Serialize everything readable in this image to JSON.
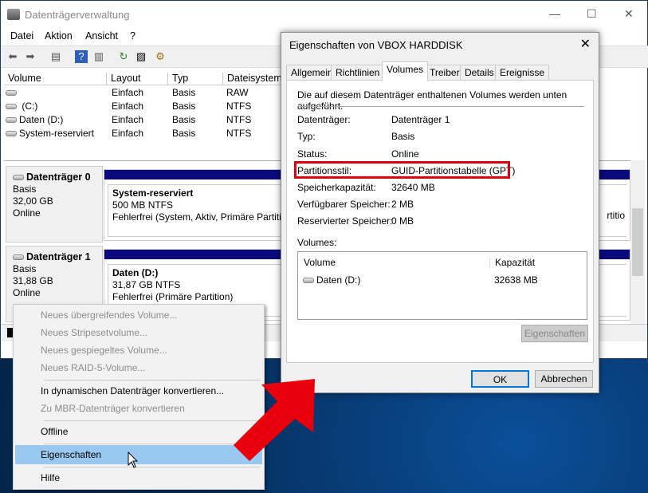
{
  "main": {
    "title": "Datenträgerverwaltung",
    "menu": [
      "Datei",
      "Aktion",
      "Ansicht",
      "?"
    ],
    "columns": [
      "Volume",
      "Layout",
      "Typ",
      "Dateisystem"
    ],
    "volumes": [
      {
        "name": "",
        "layout": "Einfach",
        "typ": "Basis",
        "fs": "RAW"
      },
      {
        "name": "(C:)",
        "layout": "Einfach",
        "typ": "Basis",
        "fs": "NTFS"
      },
      {
        "name": "Daten (D:)",
        "layout": "Einfach",
        "typ": "Basis",
        "fs": "NTFS"
      },
      {
        "name": "System-reserviert",
        "layout": "Einfach",
        "typ": "Basis",
        "fs": "NTFS"
      }
    ],
    "disks": [
      {
        "name": "Datenträger 0",
        "type": "Basis",
        "size": "32,00 GB",
        "status": "Online",
        "part_name": "System-reserviert",
        "part_size": "500 MB NTFS",
        "part_status": "Fehlerfrei (System, Aktiv, Primäre Partitio",
        "part_tail": "rtitio"
      },
      {
        "name": "Datenträger 1",
        "type": "Basis",
        "size": "31,88 GB",
        "status": "Online",
        "part_name": "Daten  (D:)",
        "part_size": "31,87 GB NTFS",
        "part_status": "Fehlerfrei (Primäre Partition)"
      }
    ]
  },
  "context_menu": {
    "items": [
      "Neues übergreifendes Volume...",
      "Neues Stripesetvolume...",
      "Neues gespiegeltes Volume...",
      "Neues RAID-5-Volume...",
      "In dynamischen Datenträger konvertieren...",
      "Zu MBR-Datenträger konvertieren",
      "Offline",
      "Eigenschaften",
      "Hilfe"
    ]
  },
  "dialog": {
    "title": "Eigenschaften von VBOX HARDDISK",
    "tabs": [
      "Allgemein",
      "Richtlinien",
      "Volumes",
      "Treiber",
      "Details",
      "Ereignisse"
    ],
    "intro": "Die auf diesem Datenträger enthaltenen Volumes werden unten aufgeführt.",
    "props": [
      [
        "Datenträger:",
        "Datenträger 1"
      ],
      [
        "Typ:",
        "Basis"
      ],
      [
        "Status:",
        "Online"
      ],
      [
        "Partitionsstil:",
        "GUID-Partitionstabelle (GPT)"
      ],
      [
        "Speicherkapazität:",
        "32640 MB"
      ],
      [
        "Verfügbarer Speicher:",
        "2 MB"
      ],
      [
        "Reservierter Speicher:",
        "0 MB"
      ]
    ],
    "volumes_label": "Volumes:",
    "vol_cols": [
      "Volume",
      "Kapazität"
    ],
    "vol_rows": [
      [
        "Daten (D:)",
        "32638 MB"
      ]
    ],
    "props_button": "Eigenschaften",
    "ok": "OK",
    "cancel": "Abbrechen"
  },
  "highlight_color": "#e0000b"
}
